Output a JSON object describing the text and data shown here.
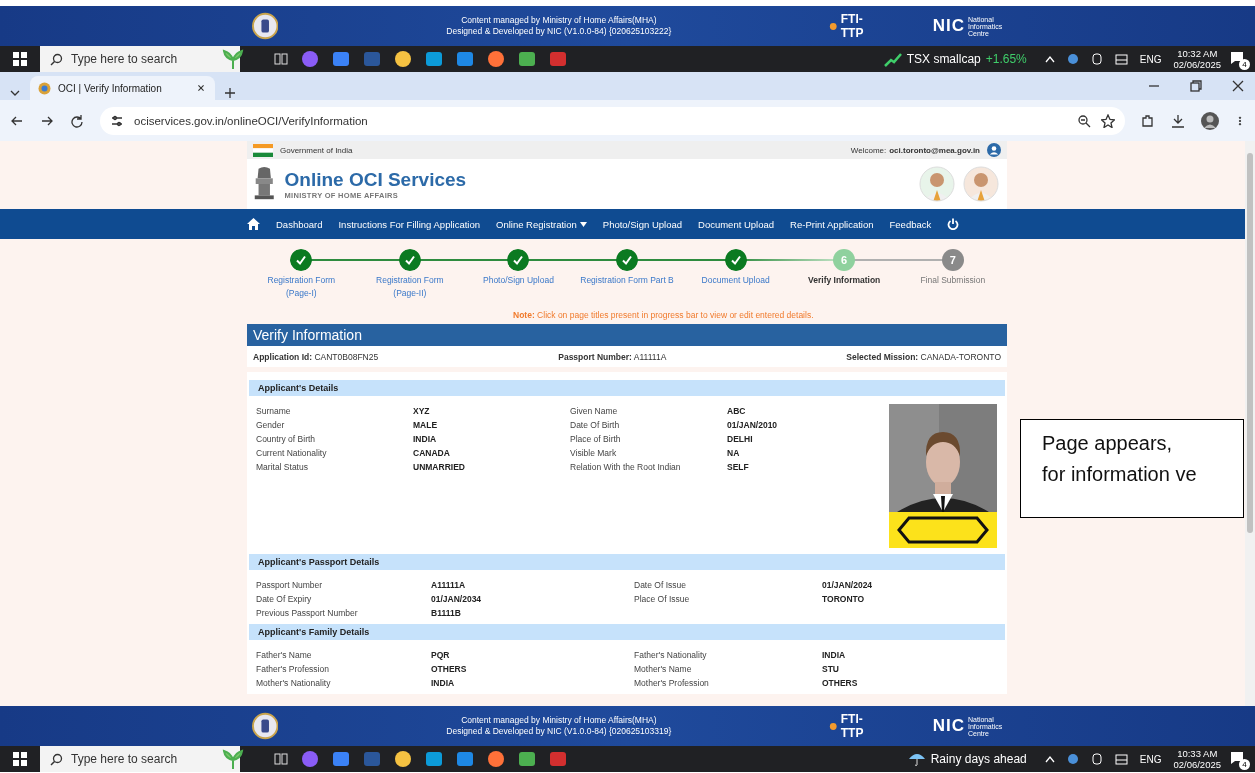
{
  "banner_top": {
    "lines": [
      "Content managed by Ministry of Home Affairs(MHA)",
      "Designed & Developed by NIC (V1.0.0-84) {020625103222}"
    ],
    "fti_logo": "FTI-TTP",
    "nic_logo": {
      "mark": "NIC",
      "caption": "National Informatics Centre"
    }
  },
  "taskbar_top": {
    "search_placeholder": "Type here to search",
    "widget": {
      "kind": "stock",
      "label": "TSX smallcap",
      "change": "+1.65%"
    },
    "language": "ENG",
    "time": "10:32 AM",
    "date": "02/06/2025",
    "notifications": "4"
  },
  "browser": {
    "tab_title": "OCI | Verify Information",
    "url": "ociservices.gov.in/onlineOCI/VerifyInformation"
  },
  "gov_strip": {
    "label": "Government of India",
    "welcome": "Welcome:",
    "user": "oci.toronto@mea.gov.in"
  },
  "header": {
    "title": "Online OCI Services",
    "subtitle": "MINISTRY OF HOME AFFAIRS"
  },
  "nav": [
    {
      "label": "Dashboard",
      "dropdown": false
    },
    {
      "label": "Instructions For Filling Application",
      "dropdown": false
    },
    {
      "label": "Online Registration",
      "dropdown": true
    },
    {
      "label": "Photo/Sign Upload",
      "dropdown": false
    },
    {
      "label": "Document Upload",
      "dropdown": false
    },
    {
      "label": "Re-Print Application",
      "dropdown": false
    },
    {
      "label": "Feedback",
      "dropdown": false
    }
  ],
  "steps": [
    {
      "label": "Registration Form\n(Page-I)",
      "completed": true,
      "selected": false
    },
    {
      "label": "Registration Form\n(Page-II)",
      "completed": true,
      "selected": false
    },
    {
      "label": "Photo/Sign Upload",
      "completed": true,
      "selected": false
    },
    {
      "label": "Registration Form Part B",
      "completed": true,
      "selected": false
    },
    {
      "label": "Document Upload",
      "completed": true,
      "selected": false
    },
    {
      "number": "6",
      "label": "Verify Information",
      "completed": false,
      "selected": true
    },
    {
      "number": "7",
      "label": "Final Submission",
      "completed": false,
      "selected": false
    }
  ],
  "note": {
    "label": "Note:",
    "text": "Click on page titles present in progress bar to view or edit entered details."
  },
  "panel_title": "Verify Information",
  "summary": [
    {
      "label": "Application Id:",
      "value": "CANT0B08FN25"
    },
    {
      "label": "Passport Number:",
      "value": "A11111A"
    },
    {
      "label": "Selected Mission:",
      "value": "CANADA-TORONTO"
    }
  ],
  "sections": [
    {
      "title": "Applicant's Details",
      "fields": [
        {
          "label": "Surname",
          "value": "XYZ"
        },
        {
          "label": "Given Name",
          "value": "ABC"
        },
        {
          "label": "Gender",
          "value": "MALE"
        },
        {
          "label": "Date Of Birth",
          "value": "01/JAN/2010"
        },
        {
          "label": "Country of Birth",
          "value": "INDIA"
        },
        {
          "label": "Place of Birth",
          "value": "DELHI"
        },
        {
          "label": "Current Nationality",
          "value": "CANADA"
        },
        {
          "label": "Visible Mark",
          "value": "NA"
        },
        {
          "label": "Marital Status",
          "value": "UNMARRIED"
        },
        {
          "label": "Relation With the Root Indian",
          "value": "SELF"
        }
      ]
    },
    {
      "title": "Applicant's Passport Details",
      "fields": [
        {
          "label": "Passport Number",
          "value": "A11111A"
        },
        {
          "label": "Date Of Issue",
          "value": "01/JAN/2024"
        },
        {
          "label": "Date Of Expiry",
          "value": "01/JAN/2034"
        },
        {
          "label": "Place Of Issue",
          "value": "TORONTO"
        },
        {
          "label": "Previous Passport Number",
          "value": "B1111B"
        }
      ]
    },
    {
      "title": "Applicant's Family Details",
      "fields": [
        {
          "label": "Father's Name",
          "value": "PQR"
        },
        {
          "label": "Father's Nationality",
          "value": "INDIA"
        },
        {
          "label": "Father's Profession",
          "value": "OTHERS"
        },
        {
          "label": "Mother's Name",
          "value": "STU"
        },
        {
          "label": "Mother's Nationality",
          "value": "INDIA"
        },
        {
          "label": "Mother's Profession",
          "value": "OTHERS"
        }
      ]
    }
  ],
  "callout": {
    "lines": [
      "Page appears,",
      "for information ve"
    ]
  },
  "banner_bottom": {
    "lines": [
      "Content managed by Ministry of Home Affairs(MHA)",
      "Designed & Developed by NIC (V1.0.0-84) {020625103319}"
    ],
    "fti_logo": "FTI-TTP",
    "nic_logo": {
      "mark": "NIC",
      "caption": "National Informatics Centre"
    }
  },
  "taskbar_bottom": {
    "search_placeholder": "Type here to search",
    "widget": {
      "kind": "weather",
      "label": "Rainy days ahead"
    },
    "language": "ENG",
    "time": "10:33 AM",
    "date": "02/06/2025",
    "notifications": "4"
  }
}
